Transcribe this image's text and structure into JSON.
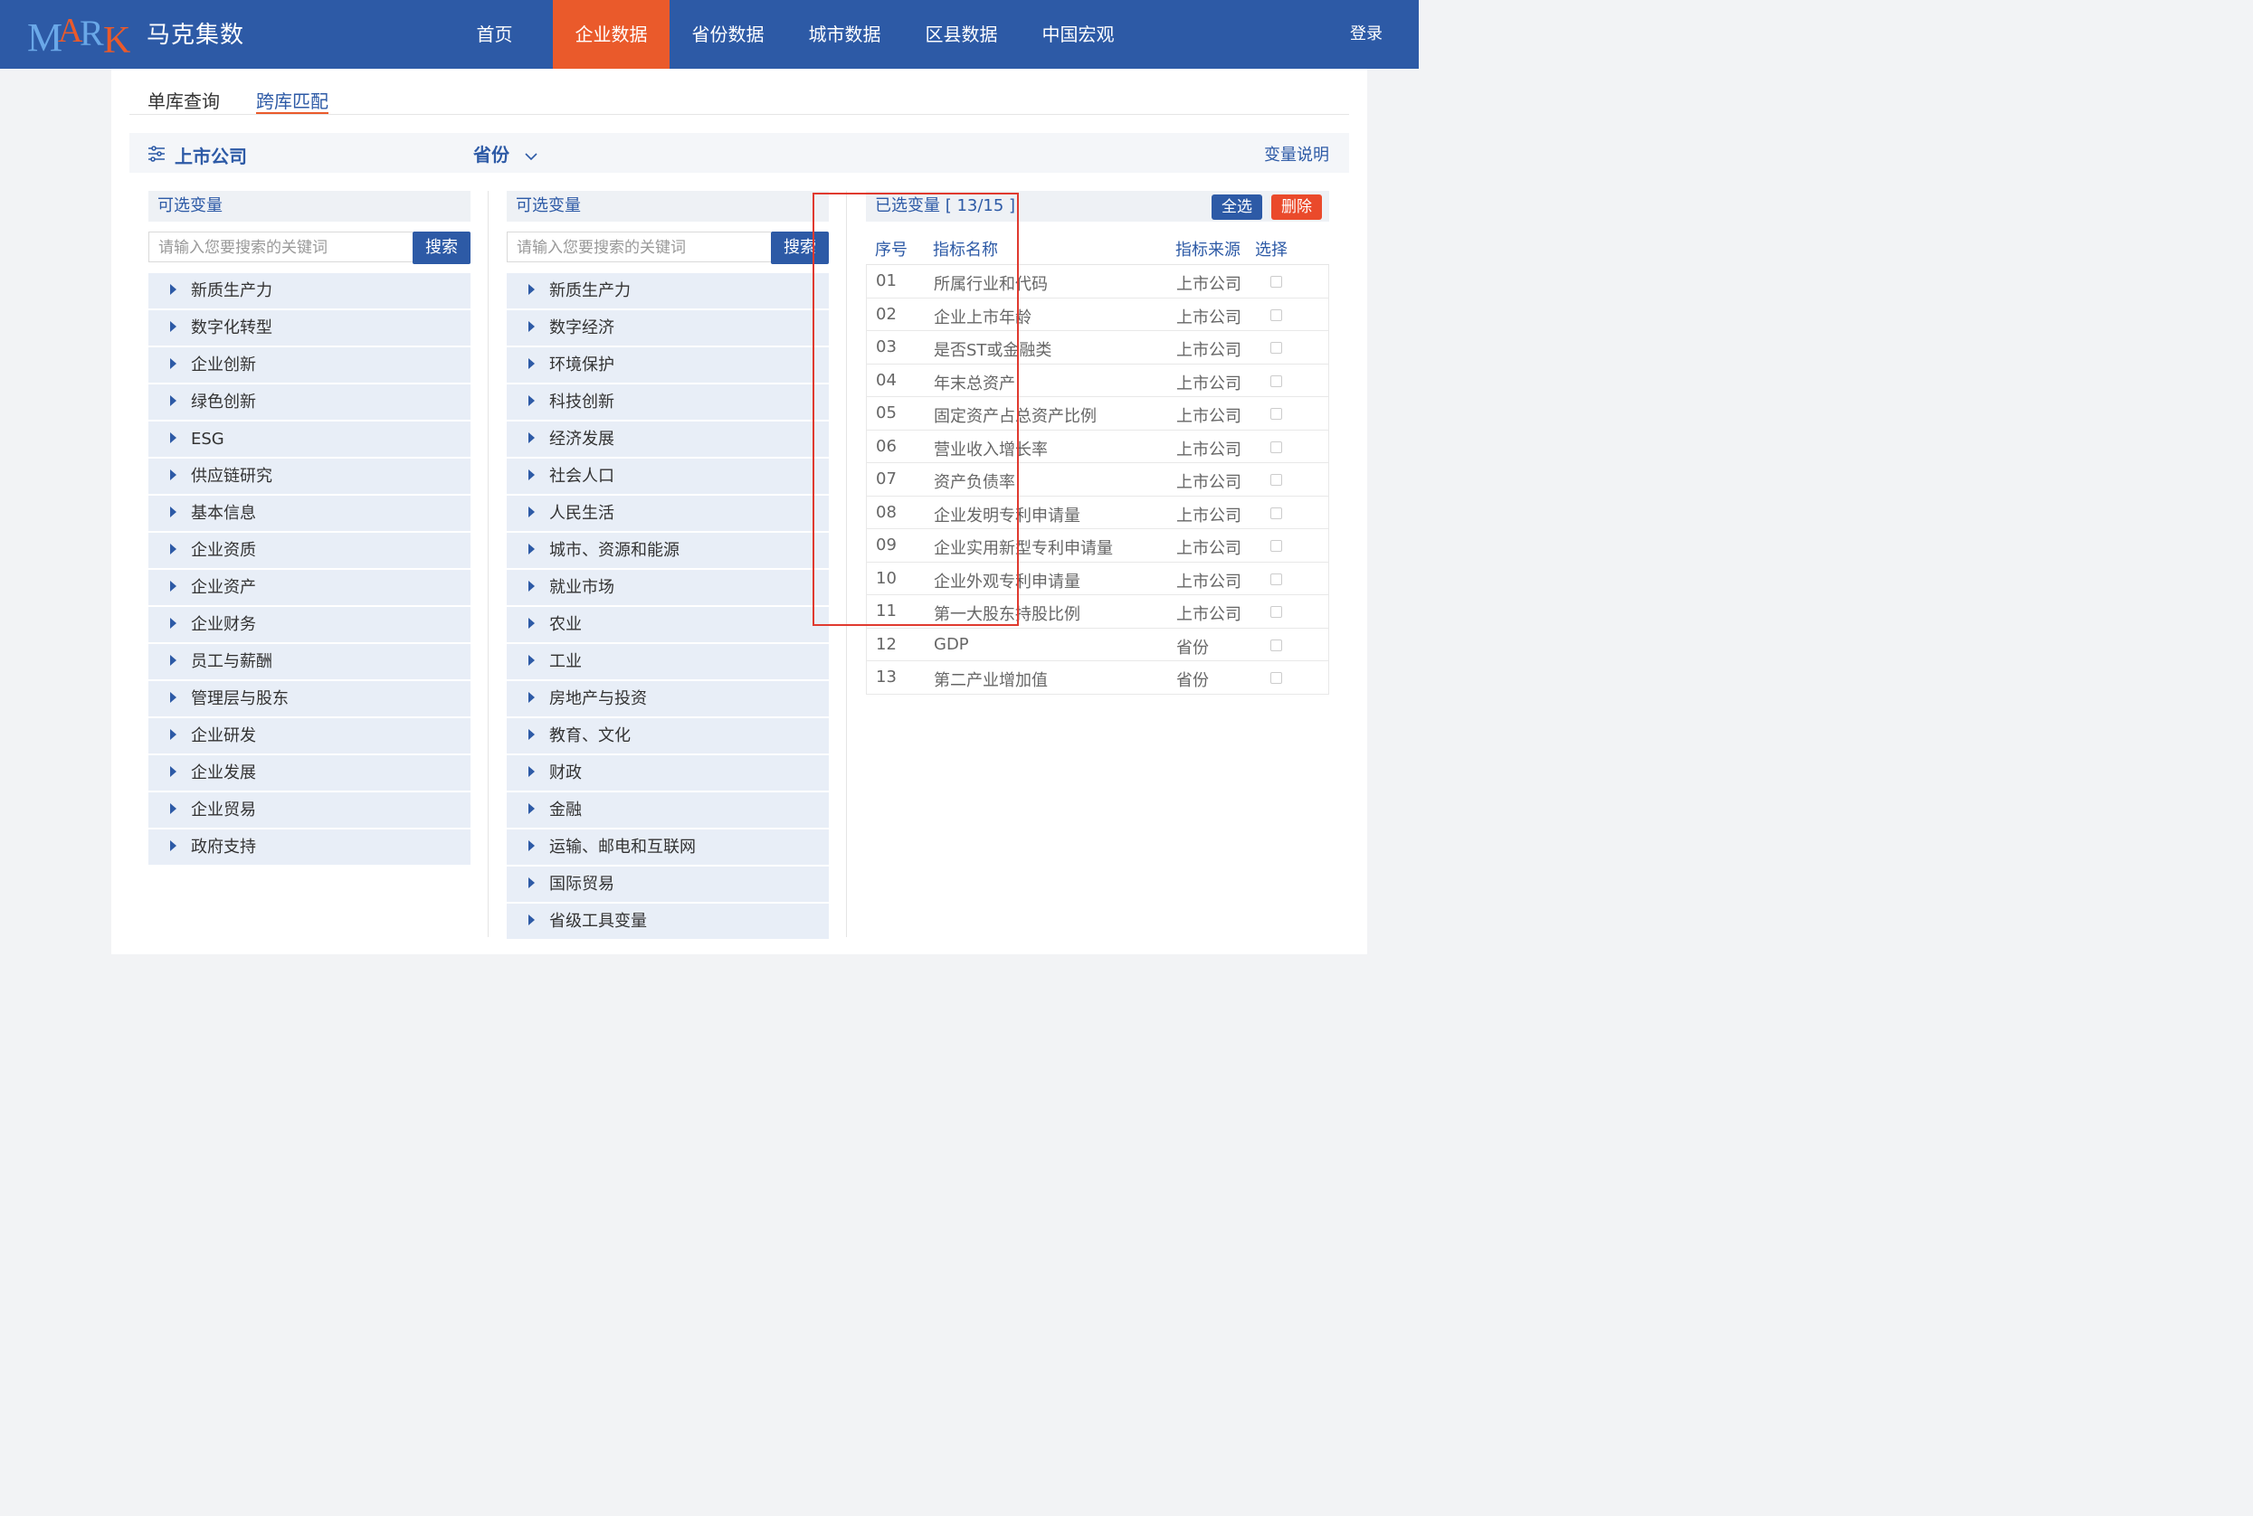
{
  "header": {
    "logo_text": "MARK",
    "brand": "马克集数",
    "nav": [
      "首页",
      "企业数据",
      "省份数据",
      "城市数据",
      "区县数据",
      "中国宏观"
    ],
    "active_nav": "企业数据",
    "login": "登录"
  },
  "tabs": {
    "single": "单库查询",
    "cross": "跨库匹配",
    "active": "跨库匹配"
  },
  "filter": {
    "title": "上市公司",
    "province": "省份",
    "help": "变量说明"
  },
  "left_panel": {
    "title": "可选变量",
    "search_placeholder": "请输入您要搜索的关键词",
    "search_button": "搜索",
    "categories": [
      "新质生产力",
      "数字化转型",
      "企业创新",
      "绿色创新",
      "ESG",
      "供应链研究",
      "基本信息",
      "企业资质",
      "企业资产",
      "企业财务",
      "员工与薪酬",
      "管理层与股东",
      "企业研发",
      "企业发展",
      "企业贸易",
      "政府支持"
    ]
  },
  "middle_panel": {
    "title": "可选变量",
    "search_placeholder": "请输入您要搜索的关键词",
    "search_button": "搜索",
    "categories": [
      "新质生产力",
      "数字经济",
      "环境保护",
      "科技创新",
      "经济发展",
      "社会人口",
      "人民生活",
      "城市、资源和能源",
      "就业市场",
      "农业",
      "工业",
      "房地产与投资",
      "教育、文化",
      "财政",
      "金融",
      "运输、邮电和互联网",
      "国际贸易",
      "省级工具变量"
    ]
  },
  "selected": {
    "title": "已选变量 [ 13/15 ]",
    "select_all": "全选",
    "delete": "删除",
    "columns": [
      "序号",
      "指标名称",
      "指标来源",
      "选择"
    ],
    "rows": [
      {
        "no": "01",
        "name": "所属行业和代码",
        "source": "上市公司"
      },
      {
        "no": "02",
        "name": "企业上市年龄",
        "source": "上市公司"
      },
      {
        "no": "03",
        "name": "是否ST或金融类",
        "source": "上市公司"
      },
      {
        "no": "04",
        "name": "年末总资产",
        "source": "上市公司"
      },
      {
        "no": "05",
        "name": "固定资产占总资产比例",
        "source": "上市公司"
      },
      {
        "no": "06",
        "name": "营业收入增长率",
        "source": "上市公司"
      },
      {
        "no": "07",
        "name": "资产负债率",
        "source": "上市公司"
      },
      {
        "no": "08",
        "name": "企业发明专利申请量",
        "source": "上市公司"
      },
      {
        "no": "09",
        "name": "企业实用新型专利申请量",
        "source": "上市公司"
      },
      {
        "no": "10",
        "name": "企业外观专利申请量",
        "source": "上市公司"
      },
      {
        "no": "11",
        "name": "第一大股东持股比例",
        "source": "上市公司"
      },
      {
        "no": "12",
        "name": "GDP",
        "source": "省份"
      },
      {
        "no": "13",
        "name": "第二产业增加值",
        "source": "省份"
      }
    ]
  },
  "colors": {
    "primary": "#2d5aa6",
    "accent": "#ea5a2b",
    "highlight_box": "#e03a2f"
  }
}
